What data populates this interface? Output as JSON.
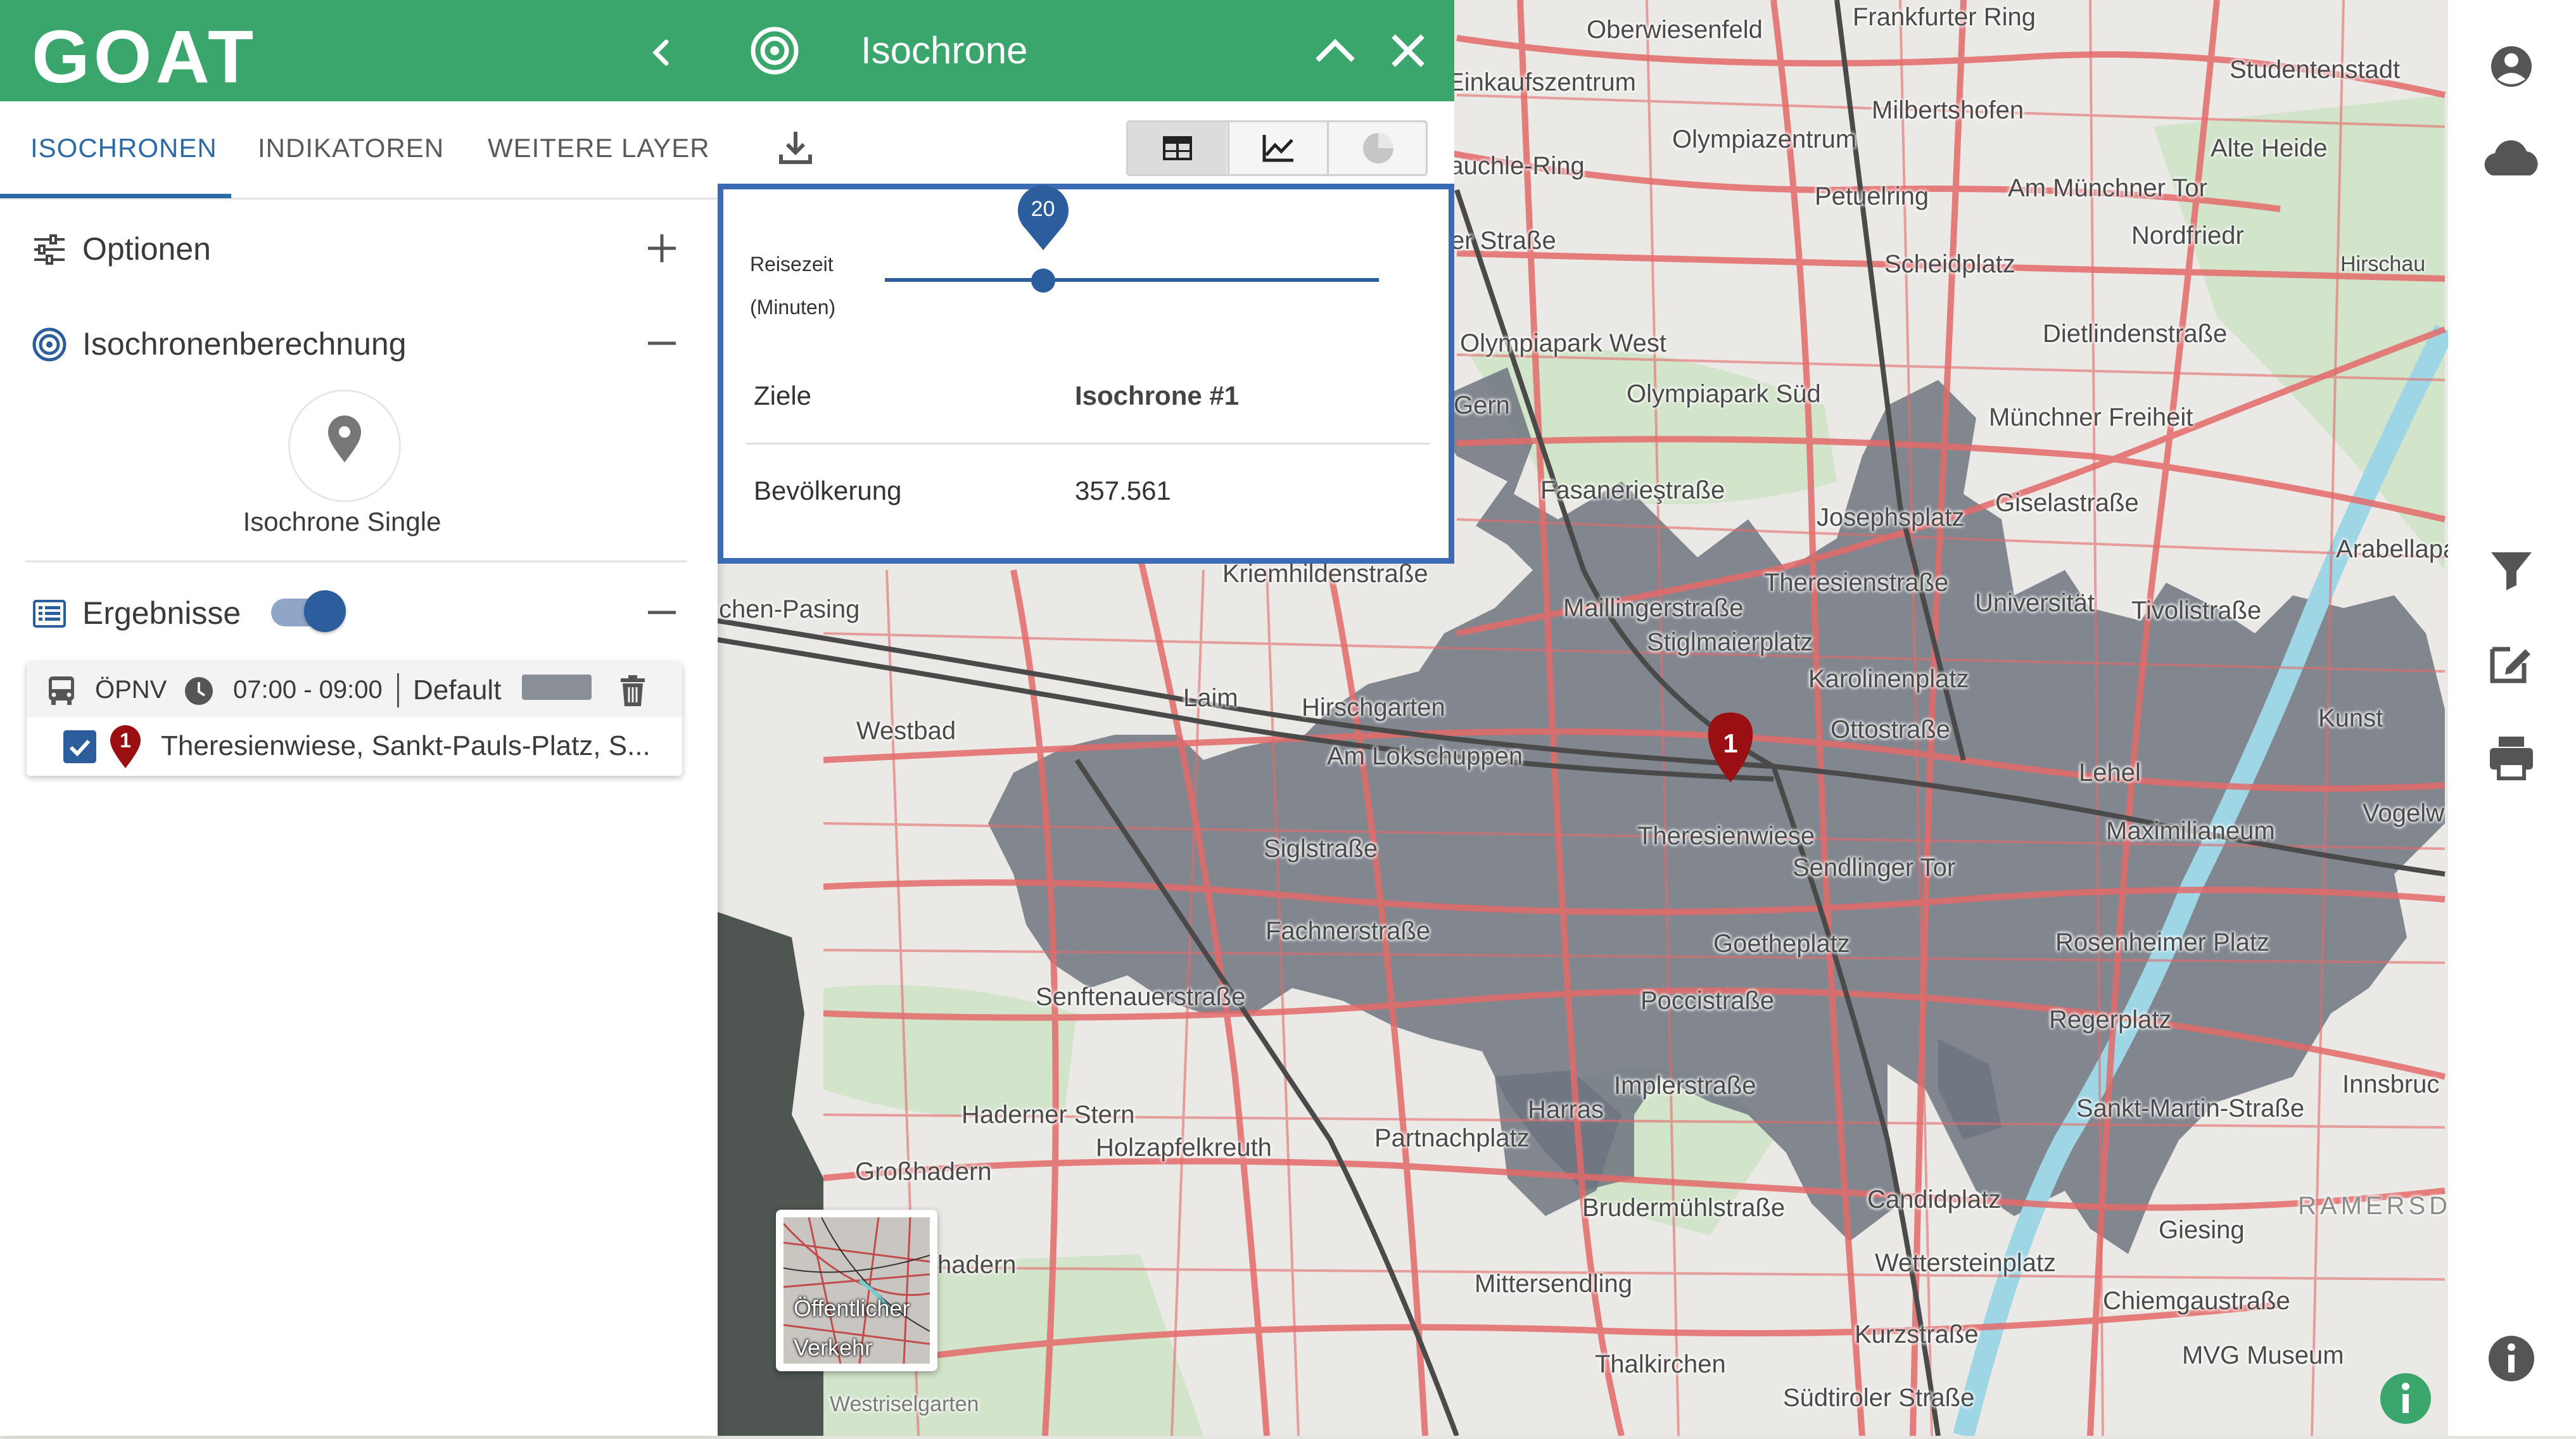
{
  "app": {
    "logo": "GOAT"
  },
  "sidebar": {
    "tabs": [
      {
        "label": "ISOCHRONEN",
        "active": true
      },
      {
        "label": "INDIKATOREN",
        "active": false
      },
      {
        "label": "WEITERE LAYER",
        "active": false
      }
    ],
    "sections": {
      "options": "Optionen",
      "calculation": "Isochronenberechnung",
      "results": "Ergebnisse"
    },
    "iso_single_label": "Isochrone Single",
    "results_toggle_on": true,
    "result_card": {
      "mode": "ÖPNV",
      "time": "07:00 - 09:00",
      "profile": "Default",
      "marker_number": "1",
      "checked": true,
      "location": "Theresienwiese, Sankt-Pauls-Platz, S..."
    }
  },
  "iso_panel": {
    "title": "Isochrone",
    "slider": {
      "label_line1": "Reisezeit",
      "label_line2": "(Minuten)",
      "value": "20",
      "fraction": 0.32
    },
    "table": {
      "headers": [
        "Ziele",
        "Isochrone #1"
      ],
      "rows": [
        {
          "name": "Bevölkerung",
          "value": "357.561"
        }
      ]
    }
  },
  "basemap": {
    "label": "Öffentlicher Verkehr"
  },
  "map": {
    "marker_number": "1",
    "colors": {
      "isochrone": "#6f7480",
      "roads": "#e46a6a",
      "rail": "#4a4a4a",
      "water": "#9fd6e6",
      "park": "#cfe3c6"
    },
    "labels": [
      "Oberwiesenfeld",
      "Frankfurter Ring",
      "Studentenstadt",
      "Einkaufszentrum",
      "Milbertshofen",
      "Olympiazentrum",
      "Alte Heide",
      "rauchle-Ring",
      "Petuelring",
      "Am Münchner Tor",
      "Nordfriedr",
      "er Straße",
      "Scheidplatz",
      "Hirschau",
      "Olympiapark West",
      "Dietlindenstraße",
      "Olympiapark Süd",
      "Gern",
      "Münchner Freiheit",
      "Fasanerieştraße",
      "Giselastraße",
      "Josephsplatz",
      "Arabellapark/K",
      "Kriemhildenstraße",
      "Theresienstraße",
      "chen-Pasing",
      "Maillingerstraße",
      "Universität",
      "Tivolistraße",
      "Stiglmaierplatz",
      "Karolinenplatz",
      "Laim",
      "Hirschgarten",
      "Westbad",
      "Ottostraße",
      "Kunst",
      "Am Lokschuppen",
      "Lehel",
      "Theresienwiese",
      "Vogelw",
      "Maximilianeum",
      "Siglstraße",
      "Sendlinger Tor",
      "Fachnerstraße",
      "Goetheplatz",
      "Rosenheimer Platz",
      "Senftenauerstraße",
      "Poccistraße",
      "Regerplatz",
      "Implerstraße",
      "Innsbruc",
      "Haderner Stern",
      "Harras",
      "Sankt-Martin-Straße",
      "Holzapfelkreuth",
      "Partnachplatz",
      "Großhadern",
      "Brudermühlstraße",
      "Candidplatz",
      "RAMERSD",
      "Giesing",
      "hadern",
      "Wettersteinplatz",
      "Mittersendling",
      "Chiemgaustraße",
      "Kurzstraße",
      "Thalkirchen",
      "MVG Museum",
      "Südtiroler Straße",
      "Westriselgarten"
    ]
  }
}
